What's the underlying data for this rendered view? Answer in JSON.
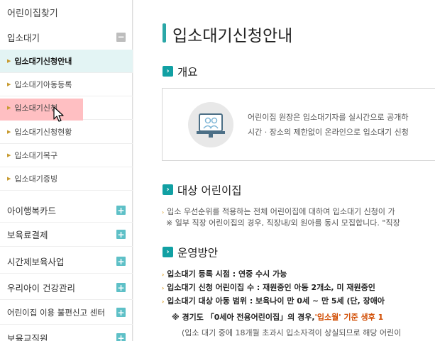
{
  "sidebar": {
    "find_daycare": "어린이집찾기",
    "waitlist_header": "입소대기",
    "sub_items": [
      {
        "label": "입소대기신청안내"
      },
      {
        "label": "입소대기아동등록"
      },
      {
        "label": "입소대기신청"
      },
      {
        "label": "입소대기신청현황"
      },
      {
        "label": "입소대기복구"
      },
      {
        "label": "입소대기증빙"
      }
    ],
    "sections": [
      {
        "label": "아이행복카드"
      },
      {
        "label": "보육료결제"
      },
      {
        "label": "시간제보육사업"
      },
      {
        "label": "우리아이 건강관리"
      },
      {
        "label": "어린이집 이용 불편신고 센터"
      },
      {
        "label": "보육교직원"
      }
    ]
  },
  "main": {
    "title": "입소대기신청안내",
    "overview": {
      "heading": "개요",
      "line1": "어린이집 원장은 입소대기자를 실시간으로 공개하",
      "line2": "시간 · 장소의 제한없이 온라인으로 입소대기 신청"
    },
    "target": {
      "heading": "대상 어린이집",
      "line1": "입소 우선순위를 적용하는 전체 어린이집에 대하여 입소대기 신청이 가",
      "line2": "※ 일부 직장 어린이집의 경우, 직장내/외 원아를 동시 모집합니다. \"직장"
    },
    "operation": {
      "heading": "운영방안",
      "line1": "입소대기 등록 시점 : 연중 수시 가능",
      "line2": "입소대기 신청 어린이집 수 : 재원중인 아동 2개소, 미 재원중인",
      "line3": "입소대기 대상 아동 범위 : 보육나이 만 0세 ~ 만 5세 (단, 장애아",
      "line4_a": "※ 경기도 「0세아 전용어린이집」의 경우,",
      "line4_b": "'입소월' 기준 생후 1",
      "line5": "(입소 대기 중에 18개월 초과시 입소자격이 상실되므로 해당 어린이"
    }
  },
  "icons": {
    "arrow": "caret-right-icon",
    "minus": "minus-square-icon",
    "plus": "plus-square-icon",
    "section": "chevron-right-icon",
    "overview": "monitor-people-icon",
    "cursor": "mouse-pointer-icon"
  },
  "colors": {
    "accent": "#2aa7a7",
    "active_bg": "#e3f4f4",
    "hover_bg": "#ffbfc2",
    "plus": "#5ec0c7",
    "highlight": "#d14b00"
  }
}
